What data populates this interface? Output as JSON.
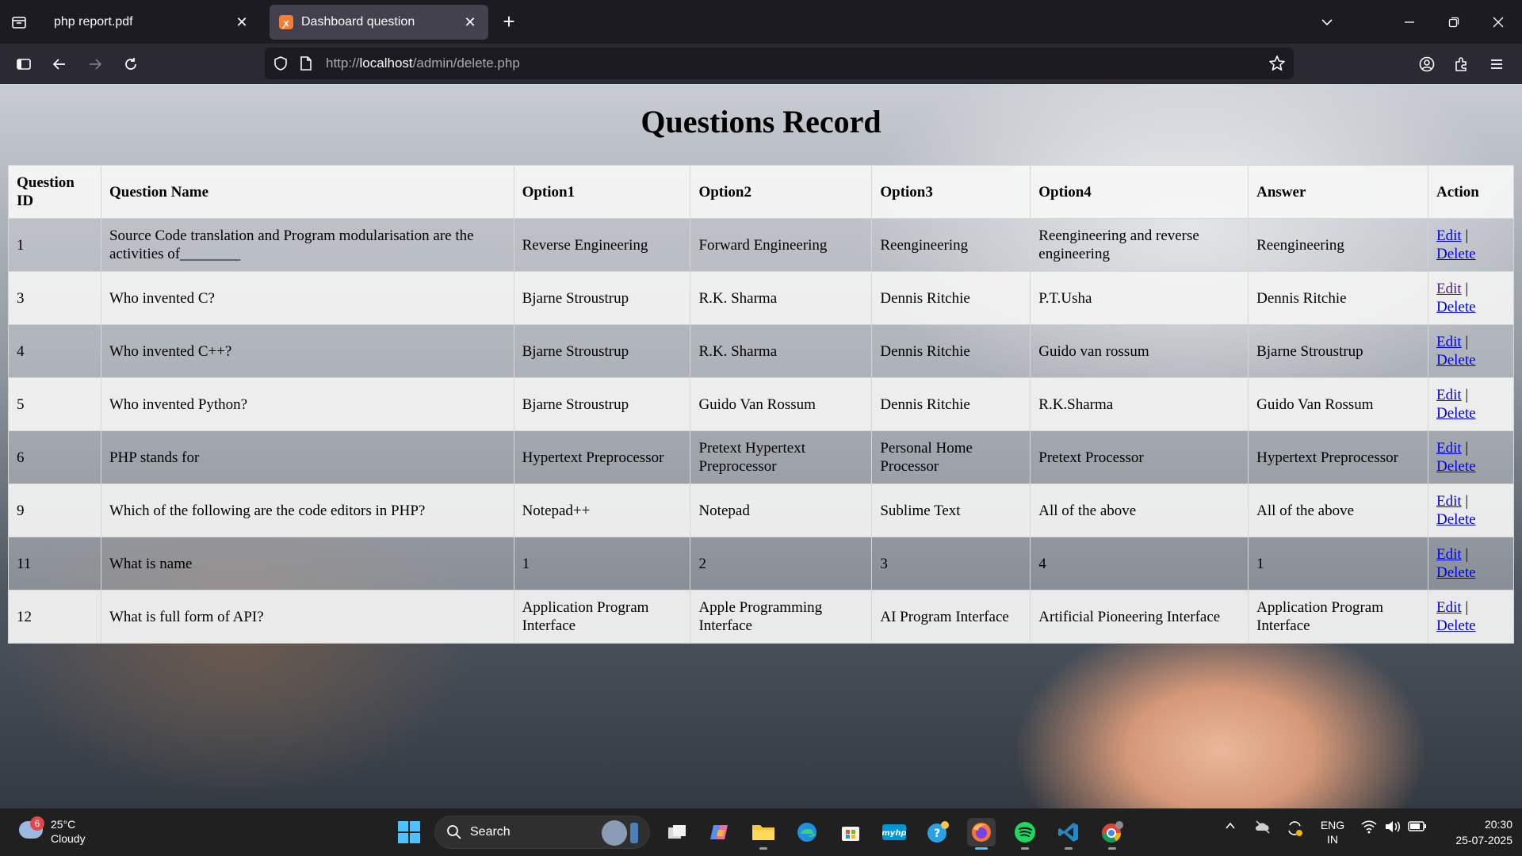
{
  "browser": {
    "tabs": [
      {
        "title": "php report.pdf",
        "active": false,
        "favicon": "pdf-icon"
      },
      {
        "title": "Dashboard question",
        "active": true,
        "favicon": "xampp-icon"
      }
    ],
    "url": {
      "scheme": "http://",
      "host": "localhost",
      "path": "/admin/delete.php"
    }
  },
  "page": {
    "title": "Questions Record",
    "table": {
      "headers": [
        "Question ID",
        "Question Name",
        "Option1",
        "Option2",
        "Option3",
        "Option4",
        "Answer",
        "Action"
      ],
      "rows": [
        {
          "id": "1",
          "question": "Source Code translation and Program modularisation are the activities of________",
          "option1": "Reverse Engineering",
          "option2": "Forward Engineering",
          "option3": "Reengineering",
          "option4": "Reengineering and reverse engineering",
          "answer": "Reengineering",
          "edit": "Edit",
          "sep": "|",
          "delete": "Delete"
        },
        {
          "id": "3",
          "question": "Who invented C?",
          "option1": "Bjarne Stroustrup",
          "option2": "R.K. Sharma",
          "option3": "Dennis Ritchie",
          "option4": "P.T.Usha",
          "answer": "Dennis Ritchie",
          "edit": "Edit",
          "sep": "|",
          "delete": "Delete"
        },
        {
          "id": "4",
          "question": "Who invented C++?",
          "option1": "Bjarne Stroustrup",
          "option2": "R.K. Sharma",
          "option3": "Dennis Ritchie",
          "option4": "Guido van rossum",
          "answer": "Bjarne Stroustrup",
          "edit": "Edit",
          "sep": "|",
          "delete": "Delete"
        },
        {
          "id": "5",
          "question": "Who invented Python?",
          "option1": "Bjarne Stroustrup",
          "option2": "Guido Van Rossum",
          "option3": "Dennis Ritchie",
          "option4": "R.K.Sharma",
          "answer": "Guido Van Rossum",
          "edit": "Edit",
          "sep": "|",
          "delete": "Delete"
        },
        {
          "id": "6",
          "question": "PHP stands for",
          "option1": "Hypertext Preprocessor",
          "option2": "Pretext Hypertext Preprocessor",
          "option3": "Personal Home Processor",
          "option4": "Pretext Processor",
          "answer": "Hypertext Preprocessor",
          "edit": "Edit",
          "sep": "|",
          "delete": "Delete"
        },
        {
          "id": "9",
          "question": "Which of the following are the code editors in PHP?",
          "option1": "Notepad++",
          "option2": "Notepad",
          "option3": "Sublime Text",
          "option4": "All of the above",
          "answer": "All of the above",
          "edit": "Edit",
          "sep": "|",
          "delete": "Delete"
        },
        {
          "id": "11",
          "question": "What is name",
          "option1": "1",
          "option2": "2",
          "option3": "3",
          "option4": "4",
          "answer": "1",
          "edit": "Edit",
          "sep": "|",
          "delete": "Delete"
        },
        {
          "id": "12",
          "question": "What is full form of API?",
          "option1": "Application Program Interface",
          "option2": "Apple Programming Interface",
          "option3": "AI Program Interface",
          "option4": "Artificial Pioneering Interface",
          "answer": "Application Program Interface",
          "edit": "Edit",
          "sep": "|",
          "delete": "Delete"
        }
      ]
    }
  },
  "taskbar": {
    "weather": {
      "temp": "25°C",
      "condition": "Cloudy",
      "badge": "6"
    },
    "search_label": "Search",
    "language": {
      "line1": "ENG",
      "line2": "IN"
    },
    "time": "20:30",
    "date": "25-07-2025",
    "apps": [
      "task-view-icon",
      "copilot-icon",
      "file-explorer-icon",
      "edge-icon",
      "store-icon",
      "myhp-icon",
      "hp-support-icon",
      "firefox-icon",
      "spotify-icon",
      "vscode-icon",
      "chrome-icon"
    ]
  },
  "colors": {
    "chrome_dark": "#1c1b22",
    "chrome_toolbar": "#2b2a33",
    "link": "#0000ee",
    "link_visited": "#551a8b",
    "accent": "#4cc2ff"
  }
}
